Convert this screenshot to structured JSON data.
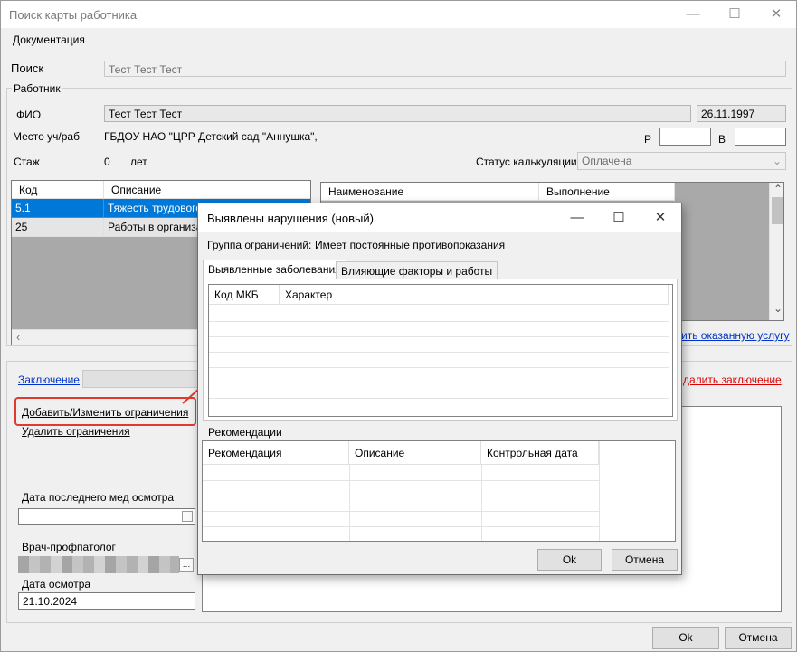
{
  "window": {
    "title": "Поиск карты работника",
    "minimize": "—",
    "maximize": "☐",
    "close": "✕"
  },
  "menu": {
    "documentation": "Документация"
  },
  "search": {
    "label": "Поиск",
    "value": "Тест Тест Тест"
  },
  "worker": {
    "group_label": "Работник",
    "fio_label": "ФИО",
    "fio_value": "Тест Тест Тест",
    "birth_date": "26.11.1997",
    "workplace_label": "Место уч/раб",
    "workplace_value": "ГБДОУ НАО \"ЦРР  Детский сад \"Аннушка\",",
    "r_label": "Р",
    "v_label": "В",
    "r_value": "",
    "v_value": "",
    "experience_label": "Стаж",
    "experience_value": "0",
    "experience_unit": "лет",
    "calc_status_label": "Статус калькуляции",
    "calc_status_value": "Оплачена"
  },
  "left_grid": {
    "columns": [
      "Код",
      "Описание"
    ],
    "rows": [
      {
        "code": "5.1",
        "desc": "Тяжесть трудового п",
        "selected": true
      },
      {
        "code": "25",
        "desc": "Работы в организац",
        "selected": false
      }
    ],
    "scroll_left_arrow": "‹"
  },
  "right_grid": {
    "columns": [
      "Наименование",
      "Выполнение"
    ],
    "scroll_up": "⌃",
    "scroll_down": "⌄",
    "link_tail": "ить оказанную услугу"
  },
  "conclusion": {
    "link": "Заключение",
    "delete_link_tail": "далить заключение",
    "add_change_link": "Добавить/Изменить ограничения",
    "delete_restrictions_link": "Удалить ограничения",
    "last_exam_label": "Дата последнего мед осмотра",
    "last_exam_value": "",
    "doctor_label": "Врач-профпатолог",
    "exam_date_label": "Дата осмотра",
    "exam_date_value": "21.10.2024"
  },
  "main_buttons": {
    "ok": "Ok",
    "cancel": "Отмена"
  },
  "dialog": {
    "title": "Выявлены нарушения (новый)",
    "minimize": "—",
    "maximize": "☐",
    "close": "✕",
    "restriction_group_label": "Группа ограничений:",
    "restriction_group_value": "Имеет постоянные противопоказания",
    "tabs": [
      "Выявленные заболевания",
      "Влияющие факторы и работы"
    ],
    "diseases_columns": [
      "Код МКБ",
      "Характер"
    ],
    "recommendations_label": "Рекомендации",
    "recommendations_columns": [
      "Рекомендация",
      "Описание",
      "Контрольная дата"
    ],
    "ok": "Ok",
    "cancel": "Отмена"
  },
  "colors": {
    "selection": "#0078d7",
    "highlight_box": "#e03a2e",
    "link": "#0033cc"
  }
}
